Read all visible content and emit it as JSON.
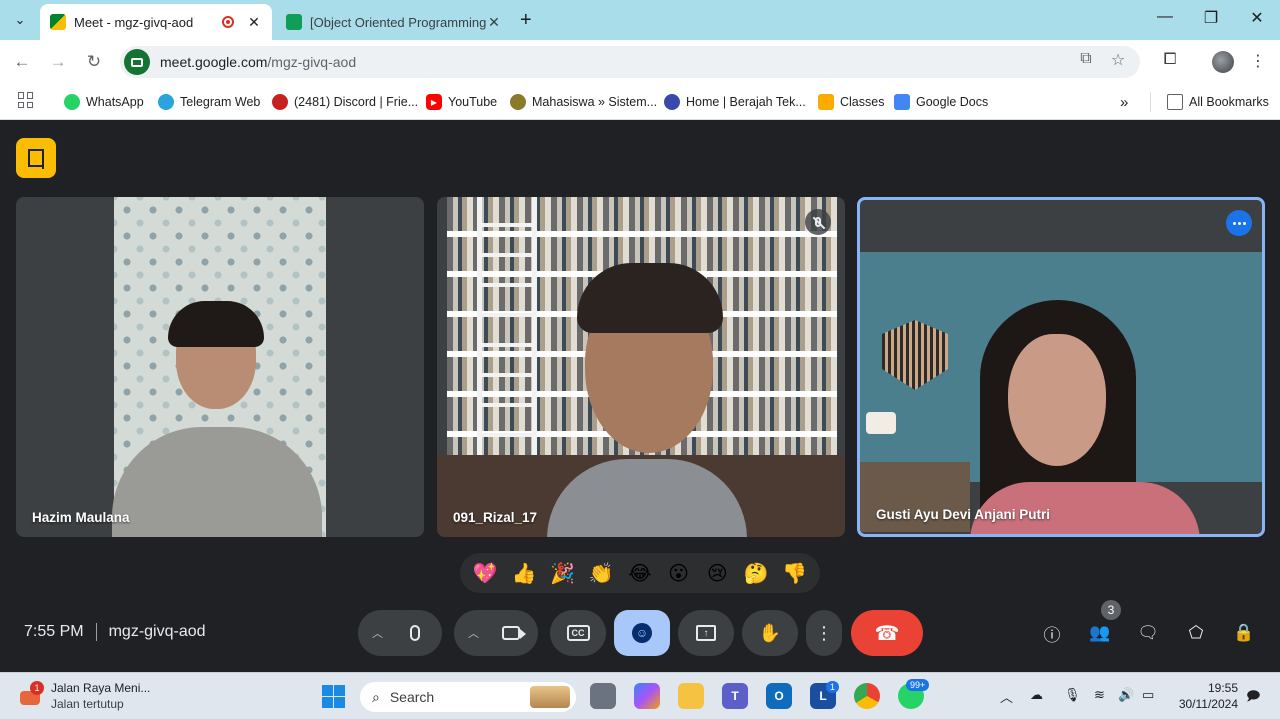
{
  "browser": {
    "tabs": [
      {
        "label": "Meet - mgz-givq-aod",
        "active": true
      },
      {
        "label": "[Object Oriented Programming",
        "active": false
      }
    ],
    "tab_close": "✕",
    "new_tab": "+",
    "url_host": "meet.google.com",
    "url_path": "/mgz-givq-aod",
    "bookmarks": [
      {
        "label": "WhatsApp",
        "icon": "whatsapp-icon",
        "color": "#25d366"
      },
      {
        "label": "Telegram Web",
        "icon": "telegram-icon",
        "color": "#2aa3df"
      },
      {
        "label": "(2481) Discord | Frie...",
        "icon": "discord-icon",
        "color": "#c5221f"
      },
      {
        "label": "YouTube",
        "icon": "youtube-icon",
        "color": "#ff0000"
      },
      {
        "label": "Mahasiswa » Sistem...",
        "icon": "campus-icon",
        "color": "#8a7a2a"
      },
      {
        "label": "Home | Berajah Tek...",
        "icon": "berajah-icon",
        "color": "#3949ab"
      },
      {
        "label": "Classes",
        "icon": "classroom-icon",
        "color": "#f9ab00"
      },
      {
        "label": "Google Docs",
        "icon": "docs-icon",
        "color": "#4285f4"
      }
    ],
    "more_bookmarks": "»",
    "all_bookmarks": "All Bookmarks"
  },
  "meet": {
    "participants": [
      {
        "name": "Hazim Maulana"
      },
      {
        "name": "091_Rizal_17"
      },
      {
        "name": "Gusti Ayu Devi Anjani Putri"
      }
    ],
    "reactions": [
      "💖",
      "👍",
      "🎉",
      "👏",
      "😂",
      "😮",
      "😢",
      "🤔",
      "👎"
    ],
    "time": "7:55 PM",
    "meeting_code": "mgz-givq-aod",
    "people_count": "3",
    "accent_color": "#8ab4f8",
    "end_call_color": "#ea4335"
  },
  "taskbar": {
    "news_title": "Jalan Raya Meni...",
    "news_subtitle": "Jalan tertutup",
    "news_badge": "1",
    "search_placeholder": "Search",
    "teams_badge": "1",
    "whatsapp_badge": "99+",
    "time": "19:55",
    "date": "30/11/2024"
  }
}
